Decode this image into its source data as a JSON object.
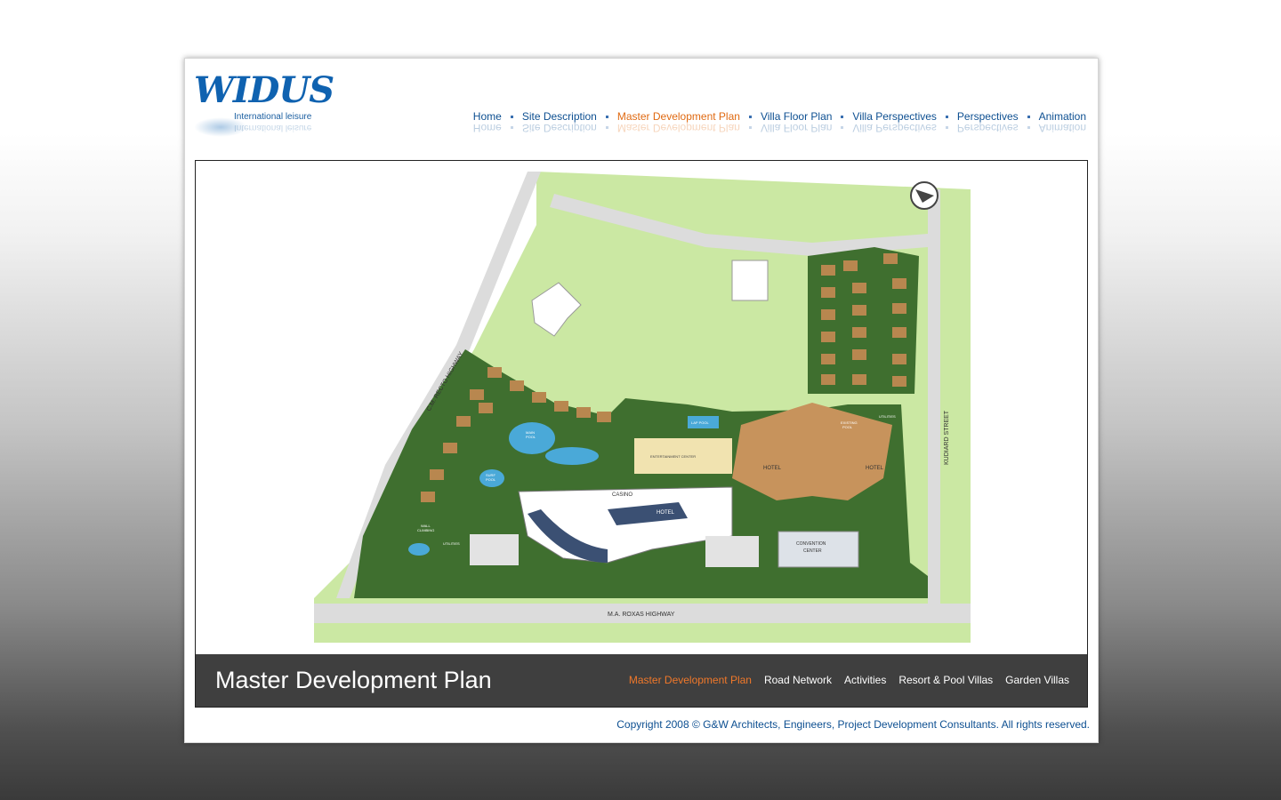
{
  "logo": {
    "brand": "WIDUS",
    "tagline": "International leisure"
  },
  "topnav": {
    "items": [
      {
        "label": "Home"
      },
      {
        "label": "Site Description"
      },
      {
        "label": "Master Development Plan",
        "active": true
      },
      {
        "label": "Villa Floor Plan"
      },
      {
        "label": "Villa Perspectives"
      },
      {
        "label": "Perspectives"
      },
      {
        "label": "Animation"
      }
    ]
  },
  "plan": {
    "labels": {
      "highway_left": "C.M. RECTO HIGHWAY",
      "highway_bottom": "M.A. ROXAS HIGHWAY",
      "street_right": "KUDIARD STREET",
      "casino": "CASINO",
      "hotel_a": "HOTEL",
      "hotel_b": "HOTEL",
      "hotel_c": "HOTEL",
      "hotel_d": "HOTEL",
      "convention_1": "CONVENTION",
      "convention_2": "CENTER",
      "main_pool_1": "MAIN",
      "main_pool_2": "POOL",
      "lap_pool": "LAP POOL",
      "entertainment": "ENTERTAINMENT CENTER",
      "existing_pool_1": "EXISTING",
      "existing_pool_2": "POOL",
      "surf_pool_1": "SURF",
      "surf_pool_2": "POOL",
      "wall_climbing_1": "WALL",
      "wall_climbing_2": "CLIMBING",
      "utilities_1": "UTILITIES",
      "utilities_2": "UTILITIES"
    },
    "colors": {
      "lawn": "#cbe8a3",
      "road": "#dcdcdc",
      "landscape": "#3f6f2f",
      "pool": "#4aa9d8",
      "roof": "#b8874f"
    }
  },
  "caption": {
    "title": "Master Development Plan",
    "subnav": [
      {
        "label": "Master Development Plan",
        "active": true
      },
      {
        "label": "Road Network"
      },
      {
        "label": "Activities"
      },
      {
        "label": "Resort & Pool Villas"
      },
      {
        "label": "Garden Villas"
      }
    ]
  },
  "footer": {
    "copyright": "Copyright 2008 © G&W Architects, Engineers, Project Development Consultants. All rights reserved."
  }
}
